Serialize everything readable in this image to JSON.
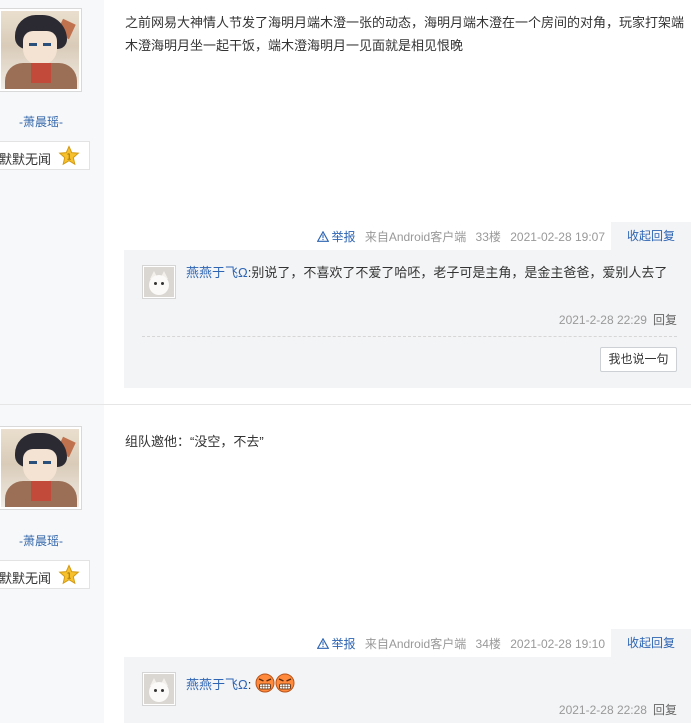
{
  "posts": [
    {
      "author": "-萧晨瑶-",
      "badge": {
        "name": "默默无闻",
        "level_icon": "star-badge-icon"
      },
      "content": "之前网易大神情人节发了海明月端木澄一张的动态，海明月端木澄在一个房间的对角，玩家打架端木澄海明月坐一起干饭，端木澄海明月一见面就是相见恨晚",
      "tail": {
        "report": "举报",
        "client": "来自Android客户端",
        "floor": "33楼",
        "time": "2021-02-28 19:07",
        "fold": "收起回复"
      },
      "replies": [
        {
          "user": "燕燕于飞Ω",
          "text": ":别说了，不喜欢了不爱了哈呸，老子可是主角，是金主爸爸，爱别人去了",
          "time": "2021-2-28 22:29",
          "reply": "回复"
        }
      ],
      "say_button": "我也说一句"
    },
    {
      "author": "-萧晨瑶-",
      "badge": {
        "name": "默默无闻",
        "level_icon": "star-badge-icon"
      },
      "content": "组队邀他：“没空，不去”",
      "tail": {
        "report": "举报",
        "client": "来自Android客户端",
        "floor": "34楼",
        "time": "2021-02-28 19:10",
        "fold": "收起回复"
      },
      "replies": [
        {
          "user": "燕燕于飞Ω",
          "text": ":",
          "emojis": [
            "angry-face-icon",
            "angry-face-icon"
          ],
          "time": "2021-2-28 22:28",
          "reply": "回复"
        }
      ]
    }
  ],
  "colors": {
    "link": "#2d64b3",
    "username": "#3366aa",
    "sidebar": "#f7f8fa",
    "reply_box": "#f3f4f6"
  }
}
